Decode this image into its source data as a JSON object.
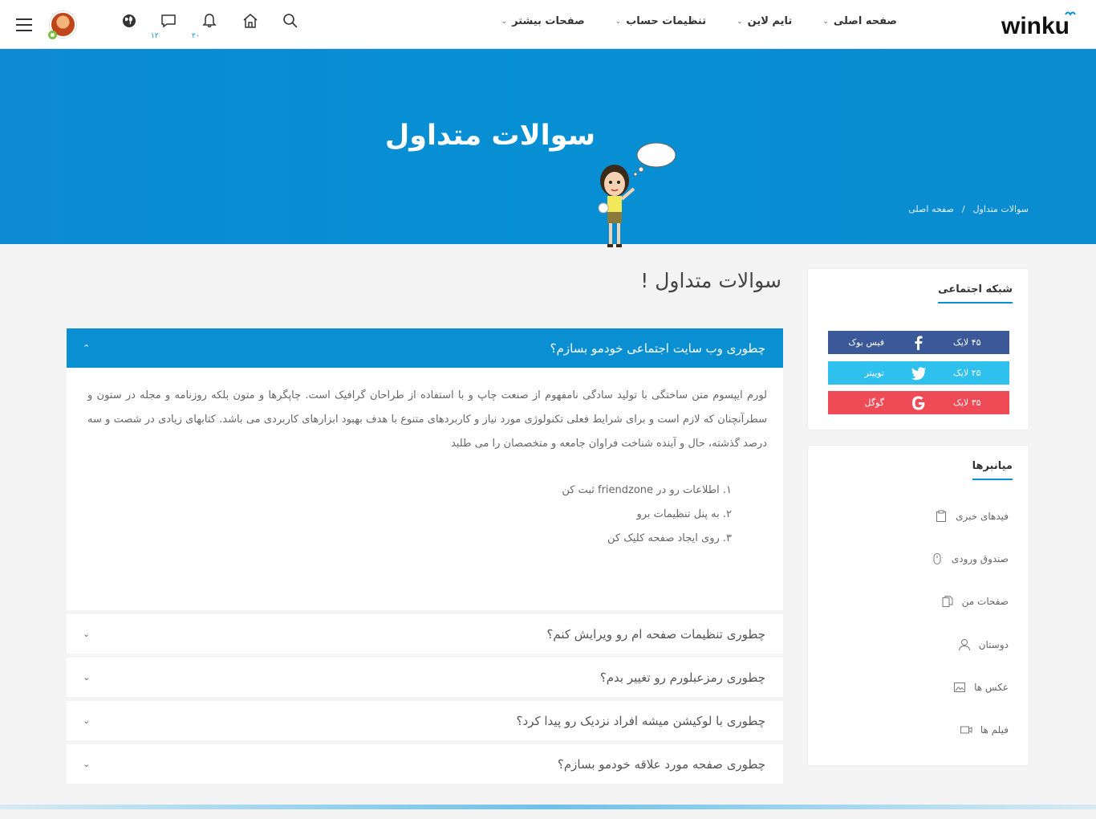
{
  "brand": {
    "logo_text": "winku",
    "accent": "#0a8fd3"
  },
  "nav": [
    {
      "label": "صفحه اصلی"
    },
    {
      "label": "تایم لاین"
    },
    {
      "label": "تنظیمات حساب"
    },
    {
      "label": "صفحات بیشتر"
    }
  ],
  "header_icons": {
    "messages_badge": "۱۲",
    "notifications_badge": "۲۰"
  },
  "banner": {
    "title": "سوالات متداول",
    "breadcrumb": [
      "صفحه اصلی",
      "/",
      "سوالات متداول"
    ]
  },
  "faq": {
    "heading": "سوالات متداول !",
    "open": {
      "question": "چطوری وب سایت اجتماعی خودمو بسازم؟",
      "body": "لورم ایپسوم متن ساختگی با تولید سادگی نامفهوم از صنعت چاپ و با استفاده از طراحان گرافیک است. چاپگرها و متون بلکه روزنامه و مجله در ستون و سطرآنچنان که لازم است و برای شرایط فعلی تکنولوژی مورد نیاز و کاربردهای متنوع با هدف بهبود ابزارهای کاربردی می باشد. کتابهای زیادی در شصت و سه درصد گذشته، حال و آینده شناخت فراوان جامعه و متخصصان را می طلبد",
      "steps": [
        "۱. اطلاعات رو در friendzone ثبت کن",
        "۲. به پنل تنظیمات برو",
        "۳. روی ایجاد صفحه کلیک کن"
      ]
    },
    "closed": [
      {
        "question": "چطوری تنظیمات صفحه ام رو ویرایش کنم؟"
      },
      {
        "question": "چطوری رمزعبلورم رو تغییر بدم؟"
      },
      {
        "question": "چطوری با لوکیشن میشه افراد نزدیک رو پیدا کرد؟"
      },
      {
        "question": "چطوری صفحه مورد علاقه خودمو بسازم؟"
      }
    ]
  },
  "social_widget": {
    "title": "شبکه اجتماعی",
    "items": [
      {
        "name": "فیس بوک",
        "likes": "۴۵ لایک",
        "icon": "facebook-icon",
        "color": "#3b5998"
      },
      {
        "name": "توییتر",
        "likes": "۲۵ لایک",
        "icon": "twitter-icon",
        "color": "#2ec1ee"
      },
      {
        "name": "گوگل",
        "likes": "۳۵ لایک",
        "icon": "google-icon",
        "color": "#ef4b56"
      }
    ]
  },
  "shortcuts_widget": {
    "title": "میانبرها",
    "items": [
      {
        "label": "فیدهای خبری",
        "icon": "clipboard-icon"
      },
      {
        "label": "صندوق ورودی",
        "icon": "mouse-icon"
      },
      {
        "label": "صفحات من",
        "icon": "files-icon"
      },
      {
        "label": "دوستان",
        "icon": "user-icon"
      },
      {
        "label": "عکس ها",
        "icon": "image-icon"
      },
      {
        "label": "فیلم ها",
        "icon": "video-icon"
      }
    ]
  }
}
